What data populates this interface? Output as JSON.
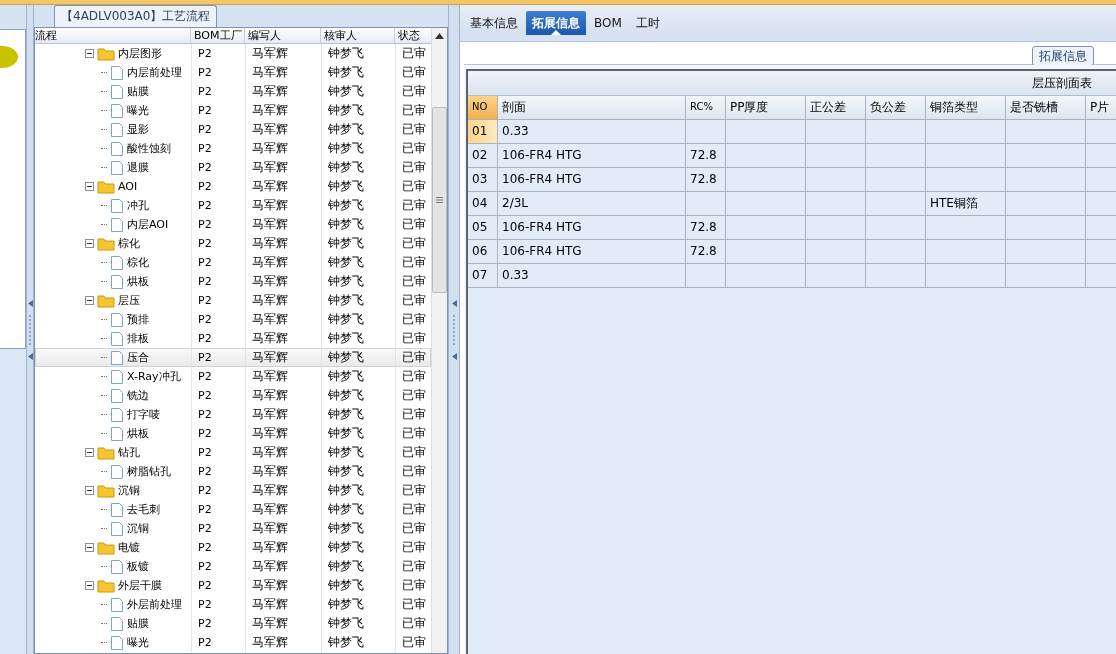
{
  "process_panel": {
    "title": "【4ADLV003A0】工艺流程",
    "columns": [
      "流程",
      "BOM工厂",
      "编写人",
      "核审人",
      "状态"
    ],
    "tree": [
      {
        "name": "内层图形",
        "bom_plant": "P2",
        "writer": "马军辉",
        "reviewer": "钟梦飞",
        "status": "已审",
        "expanded": true,
        "selected": false,
        "children": [
          {
            "name": "内层前处理",
            "bom_plant": "P2",
            "writer": "马军辉",
            "reviewer": "钟梦飞",
            "status": "已审",
            "selected": false
          },
          {
            "name": "贴膜",
            "bom_plant": "P2",
            "writer": "马军辉",
            "reviewer": "钟梦飞",
            "status": "已审",
            "selected": false
          },
          {
            "name": "曝光",
            "bom_plant": "P2",
            "writer": "马军辉",
            "reviewer": "钟梦飞",
            "status": "已审",
            "selected": false
          },
          {
            "name": "显影",
            "bom_plant": "P2",
            "writer": "马军辉",
            "reviewer": "钟梦飞",
            "status": "已审",
            "selected": false
          },
          {
            "name": "酸性蚀刻",
            "bom_plant": "P2",
            "writer": "马军辉",
            "reviewer": "钟梦飞",
            "status": "已审",
            "selected": false
          },
          {
            "name": "退膜",
            "bom_plant": "P2",
            "writer": "马军辉",
            "reviewer": "钟梦飞",
            "status": "已审",
            "selected": false
          }
        ]
      },
      {
        "name": "AOI",
        "bom_plant": "P2",
        "writer": "马军辉",
        "reviewer": "钟梦飞",
        "status": "已审",
        "expanded": true,
        "selected": false,
        "children": [
          {
            "name": "冲孔",
            "bom_plant": "P2",
            "writer": "马军辉",
            "reviewer": "钟梦飞",
            "status": "已审",
            "selected": false
          },
          {
            "name": "内层AOI",
            "bom_plant": "P2",
            "writer": "马军辉",
            "reviewer": "钟梦飞",
            "status": "已审",
            "selected": false
          }
        ]
      },
      {
        "name": "棕化",
        "bom_plant": "P2",
        "writer": "马军辉",
        "reviewer": "钟梦飞",
        "status": "已审",
        "expanded": true,
        "selected": false,
        "children": [
          {
            "name": "棕化",
            "bom_plant": "P2",
            "writer": "马军辉",
            "reviewer": "钟梦飞",
            "status": "已审",
            "selected": false
          },
          {
            "name": "烘板",
            "bom_plant": "P2",
            "writer": "马军辉",
            "reviewer": "钟梦飞",
            "status": "已审",
            "selected": false
          }
        ]
      },
      {
        "name": "层压",
        "bom_plant": "P2",
        "writer": "马军辉",
        "reviewer": "钟梦飞",
        "status": "已审",
        "expanded": true,
        "selected": false,
        "children": [
          {
            "name": "预排",
            "bom_plant": "P2",
            "writer": "马军辉",
            "reviewer": "钟梦飞",
            "status": "已审",
            "selected": false
          },
          {
            "name": "排板",
            "bom_plant": "P2",
            "writer": "马军辉",
            "reviewer": "钟梦飞",
            "status": "已审",
            "selected": false
          },
          {
            "name": "压合",
            "bom_plant": "P2",
            "writer": "马军辉",
            "reviewer": "钟梦飞",
            "status": "已审",
            "selected": true
          },
          {
            "name": "X-Ray冲孔",
            "bom_plant": "P2",
            "writer": "马军辉",
            "reviewer": "钟梦飞",
            "status": "已审",
            "selected": false
          },
          {
            "name": "铣边",
            "bom_plant": "P2",
            "writer": "马军辉",
            "reviewer": "钟梦飞",
            "status": "已审",
            "selected": false
          },
          {
            "name": "打字唛",
            "bom_plant": "P2",
            "writer": "马军辉",
            "reviewer": "钟梦飞",
            "status": "已审",
            "selected": false
          },
          {
            "name": "烘板",
            "bom_plant": "P2",
            "writer": "马军辉",
            "reviewer": "钟梦飞",
            "status": "已审",
            "selected": false
          }
        ]
      },
      {
        "name": "钻孔",
        "bom_plant": "P2",
        "writer": "马军辉",
        "reviewer": "钟梦飞",
        "status": "已审",
        "expanded": true,
        "selected": false,
        "children": [
          {
            "name": "树脂钻孔",
            "bom_plant": "P2",
            "writer": "马军辉",
            "reviewer": "钟梦飞",
            "status": "已审",
            "selected": false
          }
        ]
      },
      {
        "name": "沉铜",
        "bom_plant": "P2",
        "writer": "马军辉",
        "reviewer": "钟梦飞",
        "status": "已审",
        "expanded": true,
        "selected": false,
        "children": [
          {
            "name": "去毛刺",
            "bom_plant": "P2",
            "writer": "马军辉",
            "reviewer": "钟梦飞",
            "status": "已审",
            "selected": false
          },
          {
            "name": "沉铜",
            "bom_plant": "P2",
            "writer": "马军辉",
            "reviewer": "钟梦飞",
            "status": "已审",
            "selected": false
          }
        ]
      },
      {
        "name": "电镀",
        "bom_plant": "P2",
        "writer": "马军辉",
        "reviewer": "钟梦飞",
        "status": "已审",
        "expanded": true,
        "selected": false,
        "children": [
          {
            "name": "板镀",
            "bom_plant": "P2",
            "writer": "马军辉",
            "reviewer": "钟梦飞",
            "status": "已审",
            "selected": false
          }
        ]
      },
      {
        "name": "外层干膜",
        "bom_plant": "P2",
        "writer": "马军辉",
        "reviewer": "钟梦飞",
        "status": "已审",
        "expanded": true,
        "selected": false,
        "children": [
          {
            "name": "外层前处理",
            "bom_plant": "P2",
            "writer": "马军辉",
            "reviewer": "钟梦飞",
            "status": "已审",
            "selected": false
          },
          {
            "name": "贴膜",
            "bom_plant": "P2",
            "writer": "马军辉",
            "reviewer": "钟梦飞",
            "status": "已审",
            "selected": false
          },
          {
            "name": "曝光",
            "bom_plant": "P2",
            "writer": "马军辉",
            "reviewer": "钟梦飞",
            "status": "已审",
            "selected": false
          }
        ]
      }
    ]
  },
  "tabs": [
    {
      "label": "基本信息",
      "selected": false
    },
    {
      "label": "拓展信息",
      "selected": true
    },
    {
      "label": "BOM",
      "selected": false
    },
    {
      "label": "工时",
      "selected": false
    }
  ],
  "detail": {
    "group_title": "拓展信息",
    "table_title": "层压剖面表",
    "columns": [
      "NO",
      "剖面",
      "RC%",
      "PP厚度",
      "正公差",
      "负公差",
      "铜箔类型",
      "是否铣槽",
      "P片"
    ],
    "rows": [
      {
        "no": "01",
        "profile": "0.33",
        "selected": true
      },
      {
        "no": "02",
        "profile": "106-FR4 HTG",
        "rc_percent": "72.8",
        "selected": false
      },
      {
        "no": "03",
        "profile": "106-FR4 HTG",
        "rc_percent": "72.8",
        "selected": false
      },
      {
        "no": "04",
        "profile": "2/3L",
        "copper_foil_type": "HTE铜箔",
        "selected": false
      },
      {
        "no": "05",
        "profile": "106-FR4 HTG",
        "rc_percent": "72.8",
        "selected": false
      },
      {
        "no": "06",
        "profile": "106-FR4 HTG",
        "rc_percent": "72.8",
        "selected": false
      },
      {
        "no": "07",
        "profile": "0.33",
        "selected": false
      }
    ]
  }
}
